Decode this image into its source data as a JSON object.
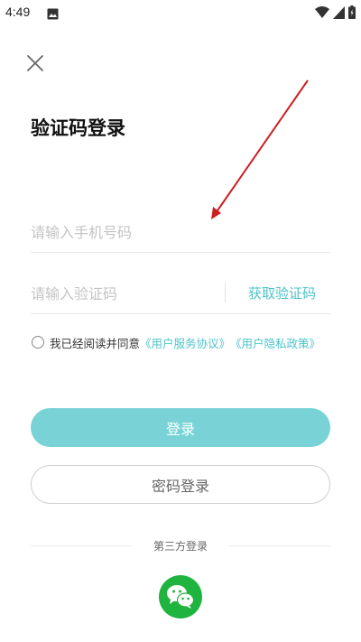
{
  "status_bar": {
    "time": "4:49",
    "icons": [
      "image-icon",
      "wifi-icon",
      "signal-icon",
      "battery-icon"
    ]
  },
  "header": {
    "close_icon": "close-icon"
  },
  "title": "验证码登录",
  "phone": {
    "placeholder": "请输入手机号码",
    "value": ""
  },
  "code": {
    "placeholder": "请输入验证码",
    "value": "",
    "get_code_label": "获取验证码"
  },
  "agreement": {
    "text": "我已经阅读并同意",
    "link_service": "《用户服务协议》",
    "link_privacy": "《用户隐私政策》",
    "checked": false
  },
  "buttons": {
    "login": "登录",
    "password_login": "密码登录"
  },
  "third_party": {
    "label": "第三方登录",
    "icon": "wechat-icon"
  },
  "annotation": {
    "type": "arrow",
    "color": "#cc1f1f"
  },
  "colors": {
    "accent": "#4cc3c9",
    "login_button": "#79d3d6",
    "wechat": "#1fb43f"
  }
}
